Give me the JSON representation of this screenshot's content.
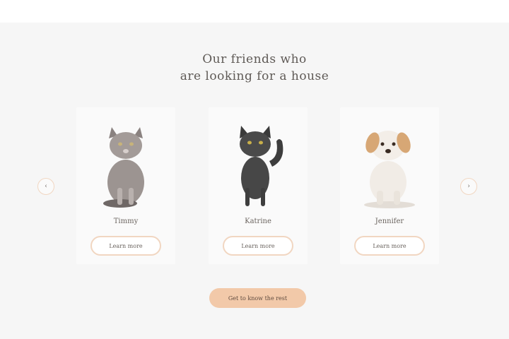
{
  "section": {
    "title_line1": "Our friends who",
    "title_line2": "are looking for a house"
  },
  "carousel": {
    "prev_icon": "‹",
    "next_icon": "›",
    "pets": [
      {
        "name": "Timmy",
        "button": "Learn more",
        "icon": "grey-cat-icon"
      },
      {
        "name": "Katrine",
        "button": "Learn more",
        "icon": "black-cat-icon"
      },
      {
        "name": "Jennifer",
        "button": "Learn more",
        "icon": "puppy-icon"
      }
    ]
  },
  "cta": {
    "label": "Get to know the rest"
  },
  "colors": {
    "accent": "#f2c9a9",
    "border": "#f1d6c1",
    "text": "#5f5a56"
  }
}
